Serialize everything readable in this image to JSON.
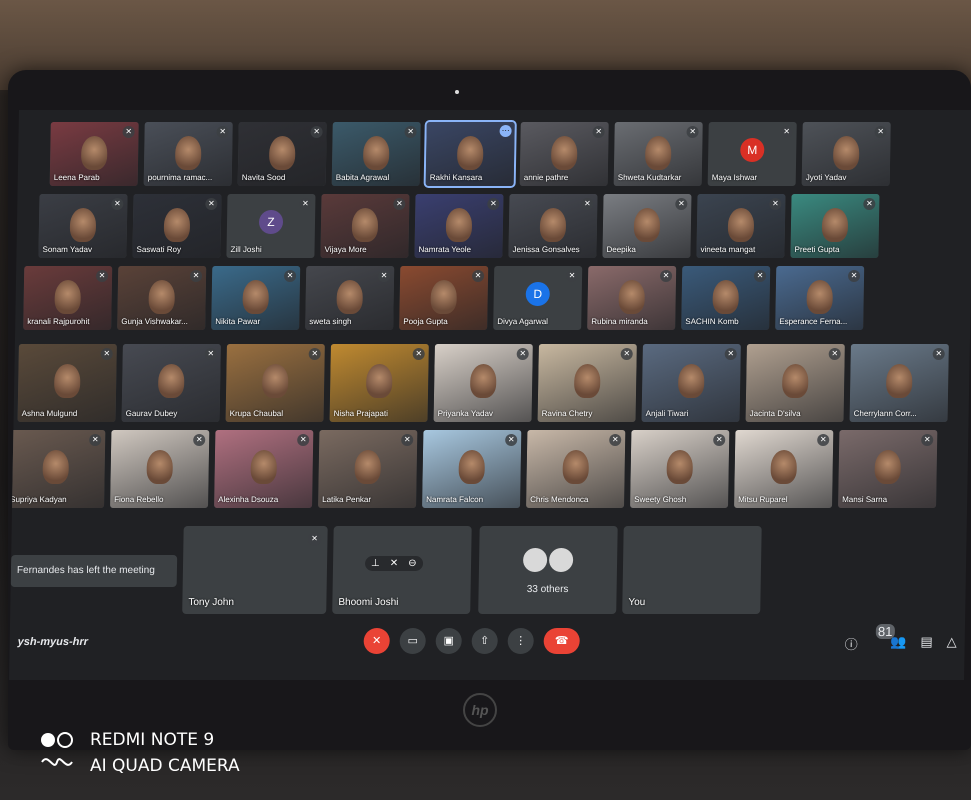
{
  "meeting": {
    "code": "ysh-myus-hrr",
    "toast": "Fernandes has left the meeting",
    "participant_badge": "81"
  },
  "rows": [
    [
      {
        "name": "Leena Parab",
        "type": "video",
        "color": "#7a3b42"
      },
      {
        "name": "pournima ramac...",
        "type": "video",
        "color": "#4a4f58"
      },
      {
        "name": "Navita Sood",
        "type": "video",
        "color": "#2f3035"
      },
      {
        "name": "Babita Agrawal",
        "type": "video",
        "color": "#3b5a6a"
      },
      {
        "name": "Rakhi Kansara",
        "type": "video",
        "color": "#3a4664",
        "active": true
      },
      {
        "name": "annie pathre",
        "type": "video",
        "color": "#5a5a60"
      },
      {
        "name": "Shweta Kudtarkar",
        "type": "video",
        "color": "#6a6d72"
      },
      {
        "name": "Maya Ishwar",
        "type": "avatar",
        "initial": "M",
        "avatar_color": "#d93025"
      },
      {
        "name": "Jyoti Yadav",
        "type": "video",
        "color": "#4e5258"
      }
    ],
    [
      {
        "name": "Sonam Yadav",
        "type": "video",
        "color": "#3b3e45"
      },
      {
        "name": "Saswati Roy",
        "type": "video",
        "color": "#2d3038"
      },
      {
        "name": "Zill Joshi",
        "type": "avatar",
        "initial": "Z",
        "avatar_color": "#5f4b8b"
      },
      {
        "name": "Vijaya More",
        "type": "video",
        "color": "#5a3a3a"
      },
      {
        "name": "Namrata Yeole",
        "type": "video",
        "color": "#3a3f70"
      },
      {
        "name": "Jenissa Gonsalves",
        "type": "video",
        "color": "#474a52"
      },
      {
        "name": "Deepika",
        "type": "video",
        "color": "#7a7d82"
      },
      {
        "name": "vineeta mangat",
        "type": "video",
        "color": "#3b4450"
      },
      {
        "name": "Preeti Gupta",
        "type": "video",
        "color": "#3a8a80"
      }
    ],
    [
      {
        "name": "kranali Rajpurohit",
        "type": "video",
        "color": "#6a3b3b"
      },
      {
        "name": "Gunja Vishwakar...",
        "type": "video",
        "color": "#5a4238"
      },
      {
        "name": "Nikita Pawar",
        "type": "video",
        "color": "#3a6a8a"
      },
      {
        "name": "sweta singh",
        "type": "video",
        "color": "#45474d"
      },
      {
        "name": "Pooja Gupta",
        "type": "video",
        "color": "#8a4a30"
      },
      {
        "name": "Divya Agarwal",
        "type": "avatar",
        "initial": "D",
        "avatar_color": "#1a73e8"
      },
      {
        "name": "Rubina miranda",
        "type": "video",
        "color": "#8a6a6a"
      },
      {
        "name": "SACHIN Komb",
        "type": "video",
        "color": "#3a5a7a"
      },
      {
        "name": "Esperance Ferna...",
        "type": "video",
        "color": "#4a6a90"
      }
    ],
    [
      {
        "name": "Ashna Mulgund",
        "type": "video",
        "color": "#5a4a3a"
      },
      {
        "name": "Gaurav Dubey",
        "type": "video",
        "color": "#474a52"
      },
      {
        "name": "Krupa Chaubal",
        "type": "video",
        "color": "#9a7040"
      },
      {
        "name": "Nisha Prajapati",
        "type": "video",
        "color": "#c08a30"
      },
      {
        "name": "Priyanka Yadav",
        "type": "video",
        "color": "#d8d0c8"
      },
      {
        "name": "Ravina Chetry",
        "type": "video",
        "color": "#c8b8a0"
      },
      {
        "name": "Anjali Tiwari",
        "type": "video",
        "color": "#5a6a80"
      },
      {
        "name": "Jacinta D'silva",
        "type": "video",
        "color": "#b0a090"
      },
      {
        "name": "Cherrylann Corr...",
        "type": "video",
        "color": "#6a7a8a"
      }
    ],
    [
      {
        "name": "Supriya Kadyan",
        "type": "video",
        "color": "#6a5a50"
      },
      {
        "name": "Fiona Rebello",
        "type": "video",
        "color": "#d0c8c0"
      },
      {
        "name": "Alexinha Dsouza",
        "type": "video",
        "color": "#b07080"
      },
      {
        "name": "Latika Penkar",
        "type": "video",
        "color": "#7a6a60"
      },
      {
        "name": "Namrata Falcon",
        "type": "video",
        "color": "#a8c8e0"
      },
      {
        "name": "Chris Mendonca",
        "type": "video",
        "color": "#c8b8a8"
      },
      {
        "name": "Sweety Ghosh",
        "type": "video",
        "color": "#d8d0c8"
      },
      {
        "name": "Mitsu Ruparel",
        "type": "video",
        "color": "#e0d8d0"
      },
      {
        "name": "Mansi Sarna",
        "type": "video",
        "color": "#7a6a6a"
      }
    ]
  ],
  "bottom_tiles": {
    "tony": {
      "name": "Tony John",
      "color": "#8a7a6a"
    },
    "bhoomi": {
      "name": "Bhoomi Joshi",
      "color": "#3a3f50"
    },
    "others": {
      "label": "33 others"
    },
    "you": {
      "name": "You",
      "color": "#8a5a70"
    }
  },
  "camera": {
    "line1": "REDMI NOTE 9",
    "line2": "AI QUAD CAMERA"
  },
  "brand": "hp"
}
